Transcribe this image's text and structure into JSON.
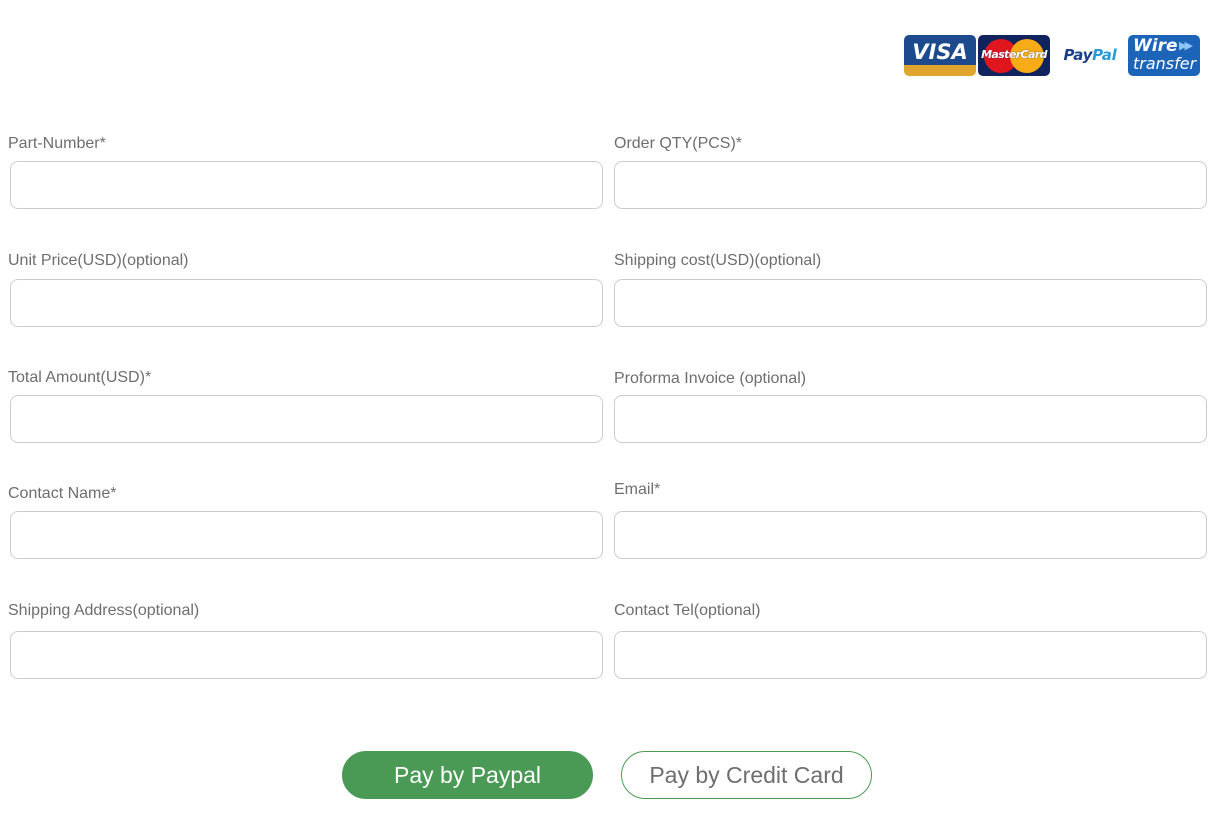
{
  "payment_logos": {
    "visa": "VISA",
    "mastercard": "MasterCard",
    "paypal_pay": "Pay",
    "paypal_pal": "Pal",
    "wire_line1": "Wire",
    "wire_line2": "transfer",
    "wire_arrows": "▶▶"
  },
  "form": {
    "fields": [
      {
        "label": "Part-Number*",
        "value": "",
        "placeholder": ""
      },
      {
        "label": "Order QTY(PCS)*",
        "value": "",
        "placeholder": ""
      },
      {
        "label": "Unit Price(USD)(optional)",
        "value": "",
        "placeholder": ""
      },
      {
        "label": "Shipping cost(USD)(optional)",
        "value": "",
        "placeholder": ""
      },
      {
        "label": "Total Amount(USD)*",
        "value": "",
        "placeholder": ""
      },
      {
        "label": "Proforma Invoice (optional)",
        "value": "",
        "placeholder": ""
      },
      {
        "label": "Contact Name*",
        "value": "",
        "placeholder": ""
      },
      {
        "label": "Email*",
        "value": "",
        "placeholder": ""
      },
      {
        "label": "Shipping Address(optional)",
        "value": "",
        "placeholder": ""
      },
      {
        "label": "Contact Tel(optional)",
        "value": "",
        "placeholder": ""
      }
    ]
  },
  "buttons": {
    "paypal_label": "Pay by Paypal",
    "credit_card_label": "Pay by Credit Card"
  },
  "colors": {
    "accent_green": "#4a9a55",
    "label_gray": "#6e6e6e",
    "input_border": "#cccccc"
  }
}
